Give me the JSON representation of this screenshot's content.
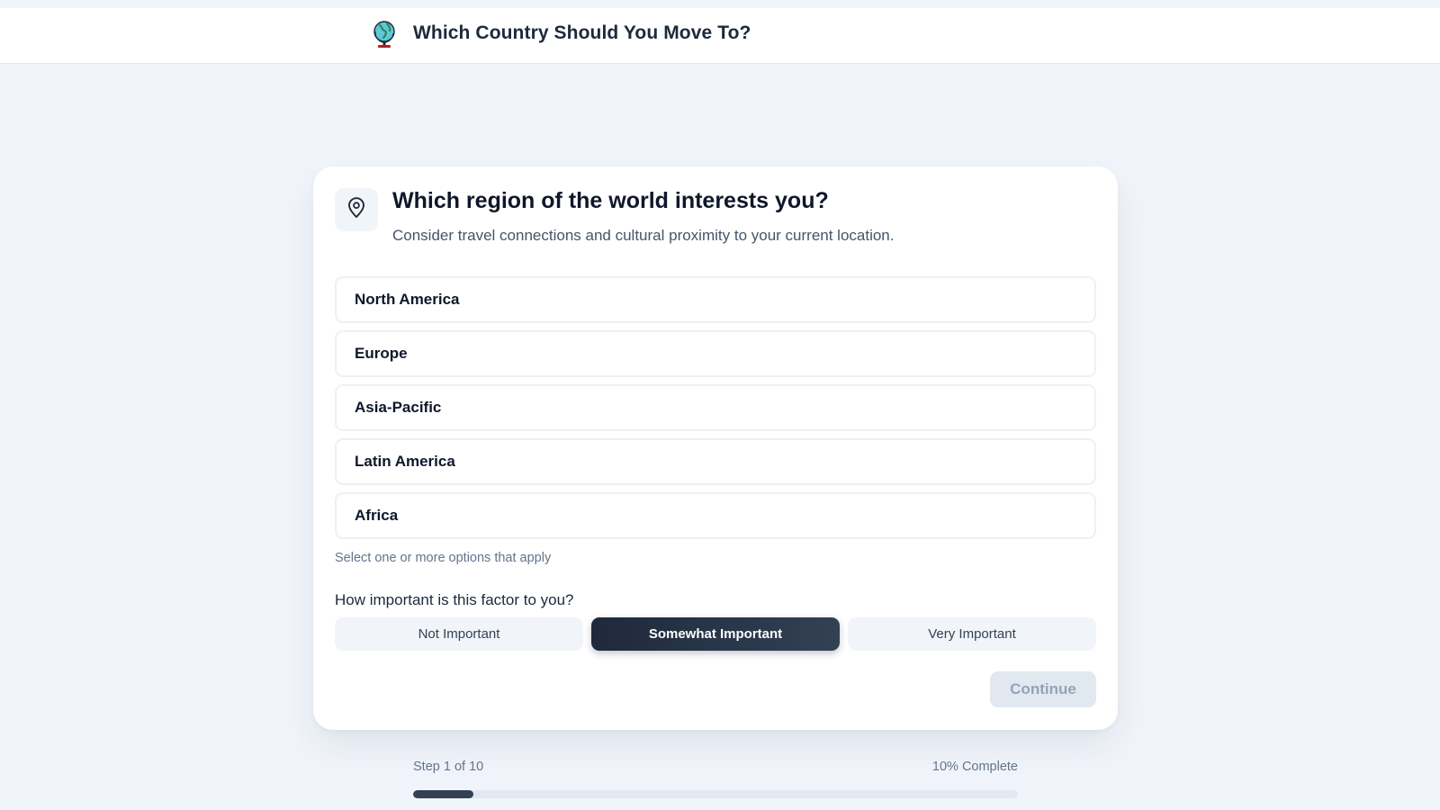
{
  "header": {
    "title": "Which Country Should You Move To?",
    "logo_icon": "globe-icon"
  },
  "question": {
    "icon": "map-pin-icon",
    "title": "Which region of the world interests you?",
    "subtitle": "Consider travel connections and cultural proximity to your current location.",
    "options": [
      {
        "label": "North America",
        "selected": false
      },
      {
        "label": "Europe",
        "selected": false
      },
      {
        "label": "Asia-Pacific",
        "selected": false
      },
      {
        "label": "Latin America",
        "selected": false
      },
      {
        "label": "Africa",
        "selected": false
      }
    ],
    "helper": "Select one or more options that apply"
  },
  "importance": {
    "question": "How important is this factor to you?",
    "options": [
      "Not Important",
      "Somewhat Important",
      "Very Important"
    ],
    "selected": "Somewhat Important"
  },
  "actions": {
    "continue_label": "Continue",
    "continue_enabled": false
  },
  "progress": {
    "step_label": "Step 1 of 10",
    "complete_label": "10% Complete",
    "fraction": 0.1
  },
  "colors": {
    "background": "#f1f5fb",
    "accent_dark": "#1e293b",
    "progress_fill": "#334155",
    "disabled": "#e2e8f0"
  }
}
